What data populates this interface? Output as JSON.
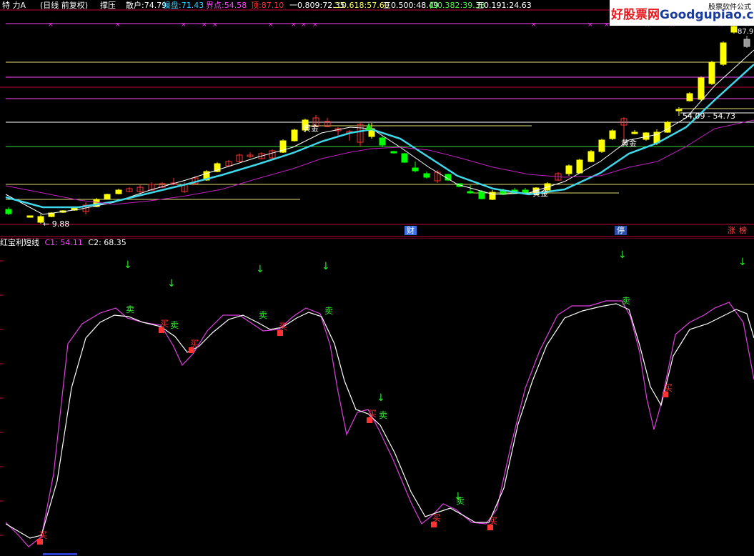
{
  "window": {
    "header_prefix": "特  力A",
    "mode": "(日线 前复权)",
    "study_name": "撑压"
  },
  "top_metrics": [
    {
      "label": "散户:",
      "value": "74.79",
      "color": "#ffffff"
    },
    {
      "label": "操盘:",
      "value": "71.43",
      "color": "#33d0ff"
    },
    {
      "label": "界点:",
      "value": "54.58",
      "color": "#ff44ff"
    },
    {
      "label": "顶:",
      "value": "87.10",
      "color": "#ff3333"
    },
    {
      "label": "一0.809:",
      "value": "72.35",
      "color": "#ffffff"
    },
    {
      "label": "二0.618:",
      "value": "57.60",
      "color": "#ffff66"
    },
    {
      "label": "三0.500:",
      "value": "48.49",
      "color": "#ffffff"
    },
    {
      "label": "四0.382:",
      "value": "39.38",
      "color": "#55ee55"
    },
    {
      "label": "五0.191:",
      "value": "24.63",
      "color": "#ffffff"
    }
  ],
  "watermark": {
    "main": "好股票网",
    "url": "Goodgupiao.com",
    "sub": "股票软件公式"
  },
  "price_labels": {
    "low": "9.88",
    "gap": "54.09 - 54.73",
    "high": "87.9"
  },
  "markers": {
    "gold_cross": "黄金",
    "buy": "买",
    "sell": "卖",
    "sell_arrow": "↓"
  },
  "events": [
    {
      "label": "财",
      "color": "#3b6fe6",
      "fg": "#ffffff"
    },
    {
      "label": "停",
      "color": "#2a4fa8",
      "fg": "#ffffff"
    },
    {
      "label": "涨",
      "color": "#000000",
      "fg": "#ff4444"
    },
    {
      "label": "榜",
      "color": "#000000",
      "fg": "#ff4444"
    }
  ],
  "indicator": {
    "name": "红宝利短线",
    "c1_label": "C1:",
    "c1_value": "54.11",
    "c2_label": "C2:",
    "c2_value": "68.35"
  },
  "colors": {
    "bg": "#000000",
    "grid": "#c0003a",
    "up": "#ffff00",
    "down": "#00ff00",
    "ma_white": "#ffffff",
    "ma_cyan": "#3fd7ea",
    "ma_magenta": "#c020c0",
    "line_c1": "#ffffff",
    "line_c2": "#e040e0"
  }
}
